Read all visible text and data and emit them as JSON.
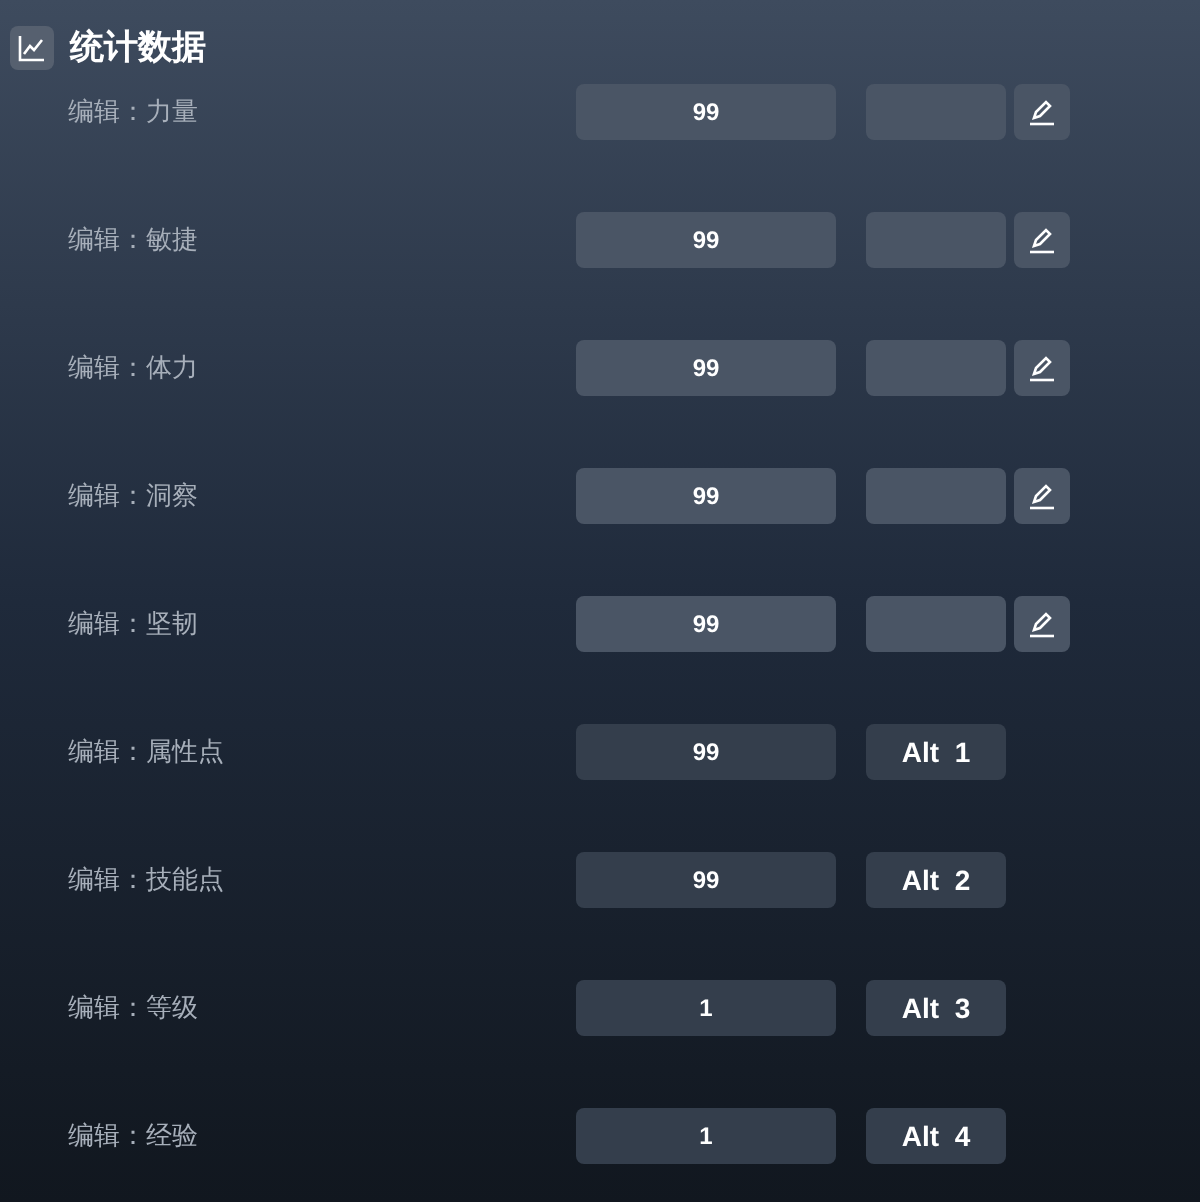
{
  "header": {
    "title": "统计数据"
  },
  "rows": [
    {
      "kind": "edit",
      "label": "编辑：力量",
      "value": "99"
    },
    {
      "kind": "edit",
      "label": "编辑：敏捷",
      "value": "99"
    },
    {
      "kind": "edit",
      "label": "编辑：体力",
      "value": "99"
    },
    {
      "kind": "edit",
      "label": "编辑：洞察",
      "value": "99"
    },
    {
      "kind": "edit",
      "label": "编辑：坚韧",
      "value": "99"
    },
    {
      "kind": "hotkey",
      "label": "编辑：属性点",
      "value": "99",
      "hotkey": "Alt  1"
    },
    {
      "kind": "hotkey",
      "label": "编辑：技能点",
      "value": "99",
      "hotkey": "Alt  2"
    },
    {
      "kind": "hotkey",
      "label": "编辑：等级",
      "value": "1",
      "hotkey": "Alt  3"
    },
    {
      "kind": "hotkey",
      "label": "编辑：经验",
      "value": "1",
      "hotkey": "Alt  4"
    }
  ]
}
